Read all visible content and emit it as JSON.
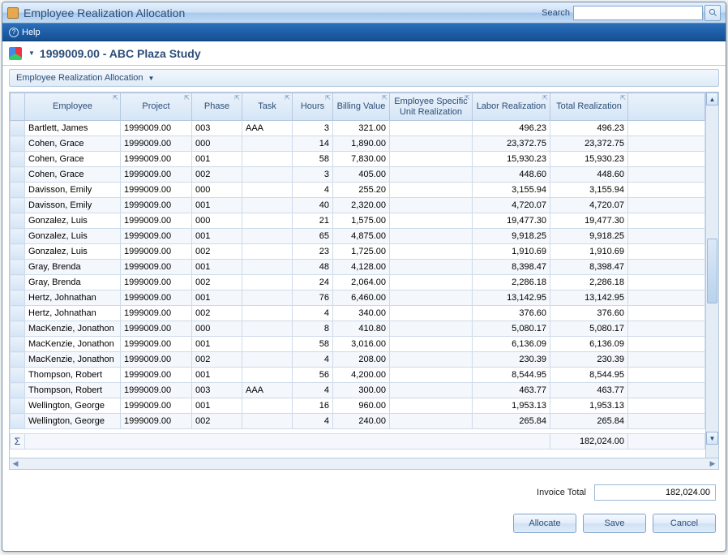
{
  "title": "Employee Realization Allocation",
  "search": {
    "label": "Search",
    "placeholder": ""
  },
  "helpbar": {
    "help_label": "Help"
  },
  "doc": {
    "title": "1999009.00 - ABC Plaza Study"
  },
  "band": {
    "title": "Employee Realization Allocation"
  },
  "columns": {
    "employee": "Employee",
    "project": "Project",
    "phase": "Phase",
    "task": "Task",
    "hours": "Hours",
    "billing": "Billing Value",
    "esur": "Employee Specific Unit Realization",
    "labor": "Labor Realization",
    "total": "Total Realization"
  },
  "rows": [
    {
      "employee": "Bartlett, James",
      "project": "1999009.00",
      "phase": "003",
      "task": "AAA",
      "hours": "3",
      "billing": "321.00",
      "esur": "",
      "labor": "496.23",
      "total": "496.23"
    },
    {
      "employee": "Cohen, Grace",
      "project": "1999009.00",
      "phase": "000",
      "task": "",
      "hours": "14",
      "billing": "1,890.00",
      "esur": "",
      "labor": "23,372.75",
      "total": "23,372.75"
    },
    {
      "employee": "Cohen, Grace",
      "project": "1999009.00",
      "phase": "001",
      "task": "",
      "hours": "58",
      "billing": "7,830.00",
      "esur": "",
      "labor": "15,930.23",
      "total": "15,930.23"
    },
    {
      "employee": "Cohen, Grace",
      "project": "1999009.00",
      "phase": "002",
      "task": "",
      "hours": "3",
      "billing": "405.00",
      "esur": "",
      "labor": "448.60",
      "total": "448.60"
    },
    {
      "employee": "Davisson, Emily",
      "project": "1999009.00",
      "phase": "000",
      "task": "",
      "hours": "4",
      "billing": "255.20",
      "esur": "",
      "labor": "3,155.94",
      "total": "3,155.94"
    },
    {
      "employee": "Davisson, Emily",
      "project": "1999009.00",
      "phase": "001",
      "task": "",
      "hours": "40",
      "billing": "2,320.00",
      "esur": "",
      "labor": "4,720.07",
      "total": "4,720.07"
    },
    {
      "employee": "Gonzalez, Luis",
      "project": "1999009.00",
      "phase": "000",
      "task": "",
      "hours": "21",
      "billing": "1,575.00",
      "esur": "",
      "labor": "19,477.30",
      "total": "19,477.30"
    },
    {
      "employee": "Gonzalez, Luis",
      "project": "1999009.00",
      "phase": "001",
      "task": "",
      "hours": "65",
      "billing": "4,875.00",
      "esur": "",
      "labor": "9,918.25",
      "total": "9,918.25"
    },
    {
      "employee": "Gonzalez, Luis",
      "project": "1999009.00",
      "phase": "002",
      "task": "",
      "hours": "23",
      "billing": "1,725.00",
      "esur": "",
      "labor": "1,910.69",
      "total": "1,910.69"
    },
    {
      "employee": "Gray, Brenda",
      "project": "1999009.00",
      "phase": "001",
      "task": "",
      "hours": "48",
      "billing": "4,128.00",
      "esur": "",
      "labor": "8,398.47",
      "total": "8,398.47"
    },
    {
      "employee": "Gray, Brenda",
      "project": "1999009.00",
      "phase": "002",
      "task": "",
      "hours": "24",
      "billing": "2,064.00",
      "esur": "",
      "labor": "2,286.18",
      "total": "2,286.18"
    },
    {
      "employee": "Hertz, Johnathan",
      "project": "1999009.00",
      "phase": "001",
      "task": "",
      "hours": "76",
      "billing": "6,460.00",
      "esur": "",
      "labor": "13,142.95",
      "total": "13,142.95"
    },
    {
      "employee": "Hertz, Johnathan",
      "project": "1999009.00",
      "phase": "002",
      "task": "",
      "hours": "4",
      "billing": "340.00",
      "esur": "",
      "labor": "376.60",
      "total": "376.60"
    },
    {
      "employee": "MacKenzie, Jonathon",
      "project": "1999009.00",
      "phase": "000",
      "task": "",
      "hours": "8",
      "billing": "410.80",
      "esur": "",
      "labor": "5,080.17",
      "total": "5,080.17"
    },
    {
      "employee": "MacKenzie, Jonathon",
      "project": "1999009.00",
      "phase": "001",
      "task": "",
      "hours": "58",
      "billing": "3,016.00",
      "esur": "",
      "labor": "6,136.09",
      "total": "6,136.09"
    },
    {
      "employee": "MacKenzie, Jonathon",
      "project": "1999009.00",
      "phase": "002",
      "task": "",
      "hours": "4",
      "billing": "208.00",
      "esur": "",
      "labor": "230.39",
      "total": "230.39"
    },
    {
      "employee": "Thompson, Robert",
      "project": "1999009.00",
      "phase": "001",
      "task": "",
      "hours": "56",
      "billing": "4,200.00",
      "esur": "",
      "labor": "8,544.95",
      "total": "8,544.95"
    },
    {
      "employee": "Thompson, Robert",
      "project": "1999009.00",
      "phase": "003",
      "task": "AAA",
      "hours": "4",
      "billing": "300.00",
      "esur": "",
      "labor": "463.77",
      "total": "463.77"
    },
    {
      "employee": "Wellington, George",
      "project": "1999009.00",
      "phase": "001",
      "task": "",
      "hours": "16",
      "billing": "960.00",
      "esur": "",
      "labor": "1,953.13",
      "total": "1,953.13"
    },
    {
      "employee": "Wellington, George",
      "project": "1999009.00",
      "phase": "002",
      "task": "",
      "hours": "4",
      "billing": "240.00",
      "esur": "",
      "labor": "265.84",
      "total": "265.84"
    }
  ],
  "sum": {
    "sigma": "Σ",
    "total": "182,024.00"
  },
  "invoice": {
    "label": "Invoice Total",
    "value": "182,024.00"
  },
  "buttons": {
    "allocate": "Allocate",
    "save": "Save",
    "cancel": "Cancel"
  }
}
